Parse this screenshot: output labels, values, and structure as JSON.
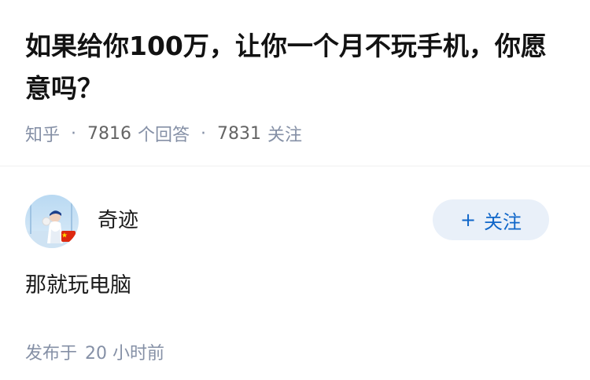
{
  "question": {
    "title": "如果给你100万，让你一个月不玩手机，你愿意吗？",
    "source": "知乎",
    "answer_count": "7816",
    "answer_label": "个回答",
    "follow_count": "7831",
    "follow_label": "关注"
  },
  "answer": {
    "author_name": "奇迹",
    "follow_button_label": "关注",
    "content": "那就玩电脑",
    "time_prefix": "发布于",
    "time_value": "20 小时前"
  },
  "icons": {
    "follow_button_icon": "plus-icon",
    "avatar_badge": "china-flag-icon"
  },
  "colors": {
    "accent_blue": "#0f66c9",
    "follow_button_bg": "#e9f0f9",
    "meta_grey": "#8590a6"
  }
}
